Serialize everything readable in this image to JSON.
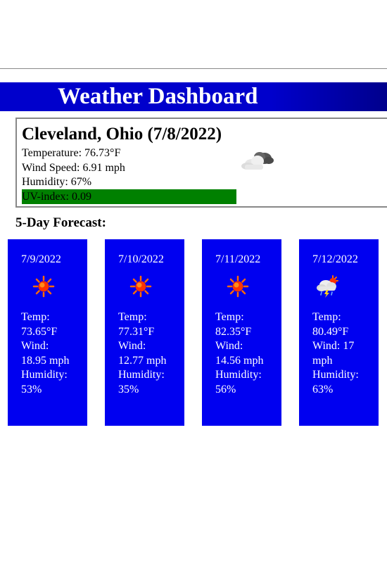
{
  "header": {
    "title": "Weather Dashboard"
  },
  "current": {
    "title": "Cleveland, Ohio (7/8/2022)",
    "temperature": "Temperature: 76.73°F",
    "wind": "Wind Speed: 6.91 mph",
    "humidity": "Humidity: 67%",
    "uv": "UV-index: 0.09",
    "uv_color": "#008000",
    "icon": "cloudy-icon"
  },
  "forecast": {
    "title": "5-Day Forecast:",
    "card_color": "#0000f0",
    "days": [
      {
        "date": "7/9/2022",
        "icon": "sun-icon",
        "temp_label": "Temp:",
        "temp": "73.65°F",
        "wind_label": "Wind:",
        "wind": "18.95 mph",
        "humidity_label": "Humidity:",
        "humidity": "53%"
      },
      {
        "date": "7/10/2022",
        "icon": "sun-icon",
        "temp_label": "Temp:",
        "temp": "77.31°F",
        "wind_label": "Wind:",
        "wind": "12.77 mph",
        "humidity_label": "Humidity:",
        "humidity": "35%"
      },
      {
        "date": "7/11/2022",
        "icon": "sun-icon",
        "temp_label": "Temp:",
        "temp": "82.35°F",
        "wind_label": "Wind:",
        "wind": "14.56 mph",
        "humidity_label": "Humidity:",
        "humidity": "56%"
      },
      {
        "date": "7/12/2022",
        "icon": "thunderstorm-icon",
        "temp_label": "Temp:",
        "temp": "80.49°F",
        "wind_label": "Wind:",
        "wind": "17 mph",
        "humidity_label": "Humidity:",
        "humidity": "63%"
      }
    ]
  }
}
